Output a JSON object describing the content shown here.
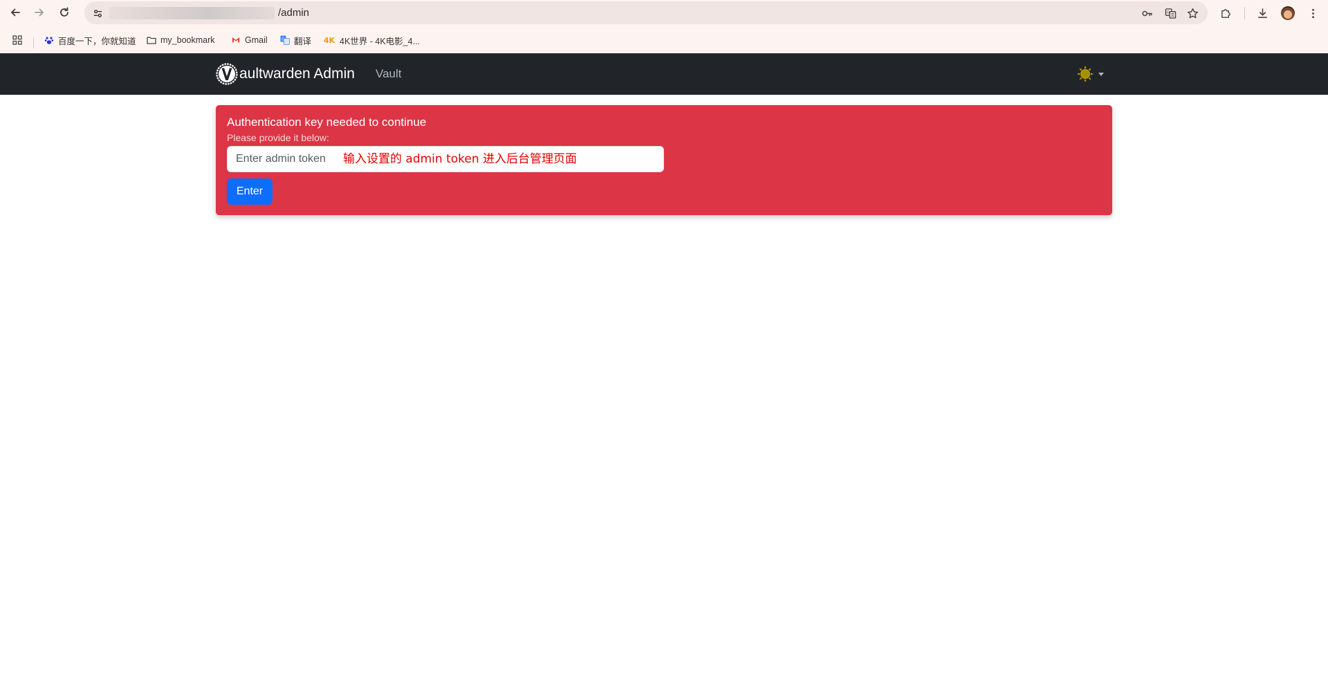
{
  "browser": {
    "url_suffix": "/admin",
    "bookmarks": [
      {
        "label": "百度一下，你就知道",
        "icon": "baidu-paw-icon"
      },
      {
        "label": "my_bookmark",
        "icon": "folder-icon"
      },
      {
        "label": "Gmail",
        "icon": "gmail-icon"
      },
      {
        "label": "翻译",
        "icon": "google-translate-icon"
      },
      {
        "label": "4K世界 - 4K电影_4...",
        "icon": "4k-icon"
      }
    ]
  },
  "navbar": {
    "brand": "aultwarden Admin",
    "vault_link": "Vault"
  },
  "auth": {
    "title": "Authentication key needed to continue",
    "subtitle": "Please provide it below:",
    "token_placeholder": "Enter admin token",
    "annotation": "输入设置的 admin token 进入后台管理页面",
    "enter_label": "Enter"
  },
  "colors": {
    "navbar_bg": "#212529",
    "alert_bg": "#dc3545",
    "button_bg": "#0d6efd",
    "annotation": "#e00000"
  }
}
